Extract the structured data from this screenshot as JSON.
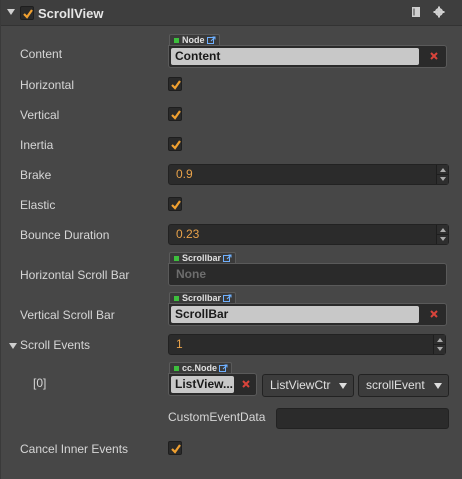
{
  "component": {
    "title": "ScrollView",
    "enabled": true
  },
  "properties": {
    "content": {
      "label": "Content",
      "type_tag": "Node",
      "value": "Content"
    },
    "horizontal": {
      "label": "Horizontal",
      "checked": true
    },
    "vertical": {
      "label": "Vertical",
      "checked": true
    },
    "inertia": {
      "label": "Inertia",
      "checked": true
    },
    "brake": {
      "label": "Brake",
      "value": "0.9"
    },
    "elastic": {
      "label": "Elastic",
      "checked": true
    },
    "bounce_duration": {
      "label": "Bounce Duration",
      "value": "0.23"
    },
    "horizontal_scroll_bar": {
      "label": "Horizontal Scroll Bar",
      "type_tag": "Scrollbar",
      "value": "None"
    },
    "vertical_scroll_bar": {
      "label": "Vertical Scroll Bar",
      "type_tag": "Scrollbar",
      "value": "ScrollBar"
    },
    "scroll_events": {
      "label": "Scroll Events",
      "count": "1"
    },
    "event_0": {
      "index_label": "[0]",
      "type_tag": "cc.Node",
      "target": "ListView...",
      "component": "ListViewCtr",
      "handler": "scrollEvent",
      "custom_label": "CustomEventData",
      "custom_value": ""
    },
    "cancel_inner_events": {
      "label": "Cancel Inner Events",
      "checked": true
    }
  },
  "colors": {
    "accent": "#e8a24a",
    "checkmark": "#f0a030",
    "node_dot": "#3dbf3d",
    "clear_x": "#d9443b"
  },
  "icons": [
    "book-icon",
    "gear-icon",
    "link-icon",
    "clear-icon",
    "checkmark-icon"
  ]
}
